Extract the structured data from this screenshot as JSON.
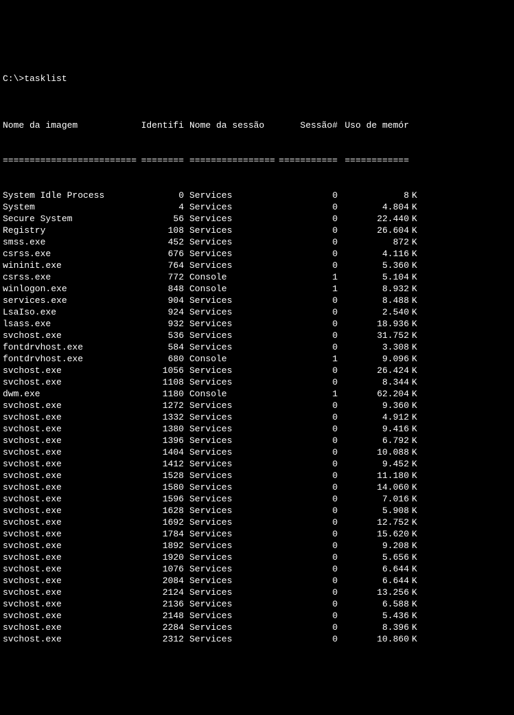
{
  "prompt": "C:\\>tasklist",
  "headers": {
    "image": "Nome da imagem",
    "pid": "Identifi",
    "session_name": "Nome da sessão",
    "session_num": "Sessão#",
    "memory": "Uso de memór"
  },
  "separators": {
    "image": "=========================",
    "pid": "========",
    "session_name": "================",
    "session_num": "===========",
    "memory": "============"
  },
  "rows": [
    {
      "image": "System Idle Process",
      "pid": "0",
      "session_name": "Services",
      "session_num": "0",
      "mem": "8",
      "unit": "K"
    },
    {
      "image": "System",
      "pid": "4",
      "session_name": "Services",
      "session_num": "0",
      "mem": "4.804",
      "unit": "K"
    },
    {
      "image": "Secure System",
      "pid": "56",
      "session_name": "Services",
      "session_num": "0",
      "mem": "22.440",
      "unit": "K"
    },
    {
      "image": "Registry",
      "pid": "108",
      "session_name": "Services",
      "session_num": "0",
      "mem": "26.604",
      "unit": "K"
    },
    {
      "image": "smss.exe",
      "pid": "452",
      "session_name": "Services",
      "session_num": "0",
      "mem": "872",
      "unit": "K"
    },
    {
      "image": "csrss.exe",
      "pid": "676",
      "session_name": "Services",
      "session_num": "0",
      "mem": "4.116",
      "unit": "K"
    },
    {
      "image": "wininit.exe",
      "pid": "764",
      "session_name": "Services",
      "session_num": "0",
      "mem": "5.360",
      "unit": "K"
    },
    {
      "image": "csrss.exe",
      "pid": "772",
      "session_name": "Console",
      "session_num": "1",
      "mem": "5.104",
      "unit": "K"
    },
    {
      "image": "winlogon.exe",
      "pid": "848",
      "session_name": "Console",
      "session_num": "1",
      "mem": "8.932",
      "unit": "K"
    },
    {
      "image": "services.exe",
      "pid": "904",
      "session_name": "Services",
      "session_num": "0",
      "mem": "8.488",
      "unit": "K"
    },
    {
      "image": "LsaIso.exe",
      "pid": "924",
      "session_name": "Services",
      "session_num": "0",
      "mem": "2.540",
      "unit": "K"
    },
    {
      "image": "lsass.exe",
      "pid": "932",
      "session_name": "Services",
      "session_num": "0",
      "mem": "18.936",
      "unit": "K"
    },
    {
      "image": "svchost.exe",
      "pid": "536",
      "session_name": "Services",
      "session_num": "0",
      "mem": "31.752",
      "unit": "K"
    },
    {
      "image": "fontdrvhost.exe",
      "pid": "584",
      "session_name": "Services",
      "session_num": "0",
      "mem": "3.308",
      "unit": "K"
    },
    {
      "image": "fontdrvhost.exe",
      "pid": "680",
      "session_name": "Console",
      "session_num": "1",
      "mem": "9.096",
      "unit": "K"
    },
    {
      "image": "svchost.exe",
      "pid": "1056",
      "session_name": "Services",
      "session_num": "0",
      "mem": "26.424",
      "unit": "K"
    },
    {
      "image": "svchost.exe",
      "pid": "1108",
      "session_name": "Services",
      "session_num": "0",
      "mem": "8.344",
      "unit": "K"
    },
    {
      "image": "dwm.exe",
      "pid": "1180",
      "session_name": "Console",
      "session_num": "1",
      "mem": "62.204",
      "unit": "K"
    },
    {
      "image": "svchost.exe",
      "pid": "1272",
      "session_name": "Services",
      "session_num": "0",
      "mem": "9.360",
      "unit": "K"
    },
    {
      "image": "svchost.exe",
      "pid": "1332",
      "session_name": "Services",
      "session_num": "0",
      "mem": "4.912",
      "unit": "K"
    },
    {
      "image": "svchost.exe",
      "pid": "1380",
      "session_name": "Services",
      "session_num": "0",
      "mem": "9.416",
      "unit": "K"
    },
    {
      "image": "svchost.exe",
      "pid": "1396",
      "session_name": "Services",
      "session_num": "0",
      "mem": "6.792",
      "unit": "K"
    },
    {
      "image": "svchost.exe",
      "pid": "1404",
      "session_name": "Services",
      "session_num": "0",
      "mem": "10.088",
      "unit": "K"
    },
    {
      "image": "svchost.exe",
      "pid": "1412",
      "session_name": "Services",
      "session_num": "0",
      "mem": "9.452",
      "unit": "K"
    },
    {
      "image": "svchost.exe",
      "pid": "1528",
      "session_name": "Services",
      "session_num": "0",
      "mem": "11.180",
      "unit": "K"
    },
    {
      "image": "svchost.exe",
      "pid": "1580",
      "session_name": "Services",
      "session_num": "0",
      "mem": "14.060",
      "unit": "K"
    },
    {
      "image": "svchost.exe",
      "pid": "1596",
      "session_name": "Services",
      "session_num": "0",
      "mem": "7.016",
      "unit": "K"
    },
    {
      "image": "svchost.exe",
      "pid": "1628",
      "session_name": "Services",
      "session_num": "0",
      "mem": "5.908",
      "unit": "K"
    },
    {
      "image": "svchost.exe",
      "pid": "1692",
      "session_name": "Services",
      "session_num": "0",
      "mem": "12.752",
      "unit": "K"
    },
    {
      "image": "svchost.exe",
      "pid": "1784",
      "session_name": "Services",
      "session_num": "0",
      "mem": "15.620",
      "unit": "K"
    },
    {
      "image": "svchost.exe",
      "pid": "1892",
      "session_name": "Services",
      "session_num": "0",
      "mem": "9.208",
      "unit": "K"
    },
    {
      "image": "svchost.exe",
      "pid": "1920",
      "session_name": "Services",
      "session_num": "0",
      "mem": "5.656",
      "unit": "K"
    },
    {
      "image": "svchost.exe",
      "pid": "1076",
      "session_name": "Services",
      "session_num": "0",
      "mem": "6.644",
      "unit": "K"
    },
    {
      "image": "svchost.exe",
      "pid": "2084",
      "session_name": "Services",
      "session_num": "0",
      "mem": "6.644",
      "unit": "K"
    },
    {
      "image": "svchost.exe",
      "pid": "2124",
      "session_name": "Services",
      "session_num": "0",
      "mem": "13.256",
      "unit": "K"
    },
    {
      "image": "svchost.exe",
      "pid": "2136",
      "session_name": "Services",
      "session_num": "0",
      "mem": "6.588",
      "unit": "K"
    },
    {
      "image": "svchost.exe",
      "pid": "2148",
      "session_name": "Services",
      "session_num": "0",
      "mem": "5.436",
      "unit": "K"
    },
    {
      "image": "svchost.exe",
      "pid": "2284",
      "session_name": "Services",
      "session_num": "0",
      "mem": "8.396",
      "unit": "K"
    },
    {
      "image": "svchost.exe",
      "pid": "2312",
      "session_name": "Services",
      "session_num": "0",
      "mem": "10.860",
      "unit": "K"
    }
  ]
}
